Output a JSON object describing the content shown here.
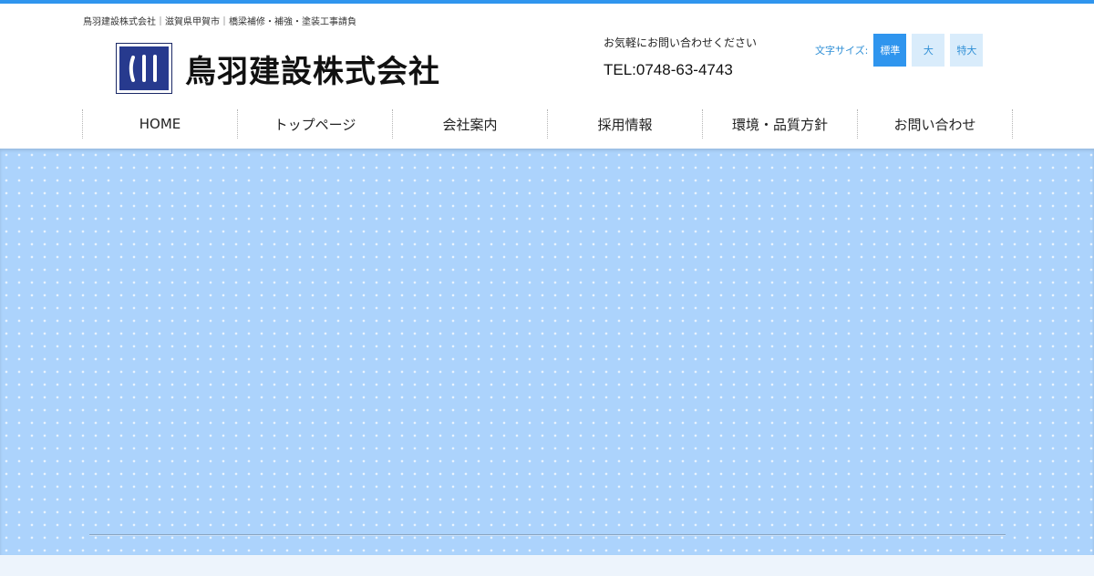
{
  "header": {
    "tagline": "鳥羽建設株式会社｜滋賀県甲賀市｜橋梁補修・補強・塗装工事請負",
    "logo_text": "鳥羽建設株式会社",
    "contact_label": "お気軽にお問い合わせください",
    "tel": "TEL:0748-63-4743"
  },
  "font_size": {
    "label": "文字サイズ:",
    "options": [
      "標準",
      "大",
      "特大"
    ],
    "selected": "標準"
  },
  "nav": {
    "items": [
      {
        "label": "HOME"
      },
      {
        "label": "トップページ"
      },
      {
        "label": "会社案内"
      },
      {
        "label": "採用情報"
      },
      {
        "label": "環境・品質方針"
      },
      {
        "label": "お問い合わせ"
      }
    ]
  },
  "colors": {
    "accent": "#2f95ee",
    "hero_bg": "#acd3fc",
    "logo_navy": "#273a8e"
  }
}
